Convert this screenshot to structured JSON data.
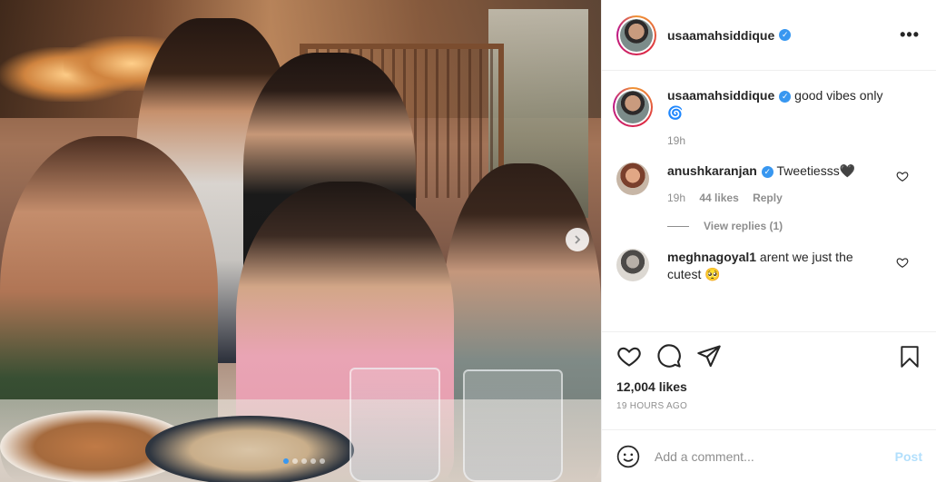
{
  "post": {
    "username": "usaamahsiddique",
    "more_icon": "more-horizontal-icon",
    "verified_icon": "verified-badge-icon",
    "image": {
      "carousel_count": 5,
      "active_index": 0
    }
  },
  "caption": {
    "username": "usaamahsiddique",
    "text": "good vibes only",
    "emoji": "🌀",
    "time": "19h"
  },
  "comments": [
    {
      "username": "anushkaranjan",
      "text": "Tweetiesss🖤",
      "time": "19h",
      "likes": "44 likes",
      "reply_label": "Reply",
      "view_replies": "View replies (1)"
    },
    {
      "username": "meghnagoyal1",
      "text": "arent we just the cutest 🥺"
    }
  ],
  "actions": {
    "likes": "12,004 likes",
    "timestamp": "19 HOURS AGO"
  },
  "add_comment": {
    "placeholder": "Add a comment...",
    "post_label": "Post"
  },
  "colors": {
    "accent": "#3897f0",
    "post_disabled": "#b2dffc",
    "muted": "#8e8e8e"
  }
}
